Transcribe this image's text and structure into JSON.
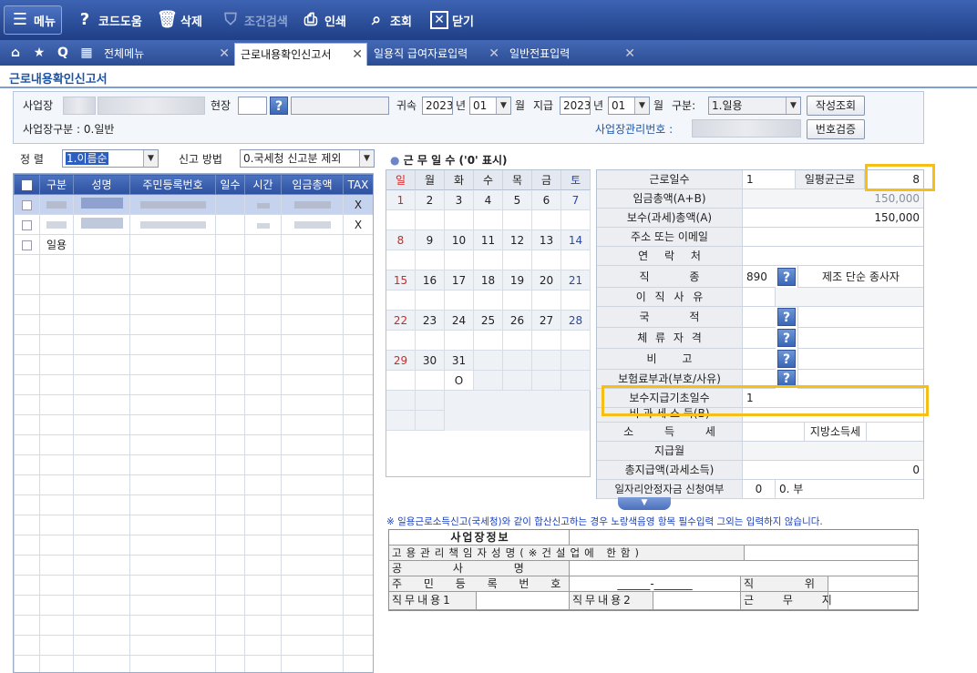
{
  "toolbar": {
    "menu": "메뉴",
    "code_help": "코드도움",
    "delete": "삭제",
    "condition_search": "조건검색",
    "print": "인쇄",
    "view": "조회",
    "close": "닫기"
  },
  "tabs": {
    "all_menu": "전체메뉴",
    "items": [
      "근로내용확인신고서",
      "일용직 급여자료입력",
      "일반전표입력"
    ]
  },
  "page_title": "근로내용확인신고서",
  "search": {
    "workplace_label": "사업장",
    "site_label": "현장",
    "year_label_1": "귀속",
    "year_1": "2023",
    "year_unit_1": "년",
    "month_1": "01",
    "month_unit_1": "월",
    "pay_label": "지급",
    "year_2": "2023",
    "year_unit_2": "년",
    "month_2": "01",
    "month_unit_2": "월",
    "type_label": "구분:",
    "type_value": "1.일용",
    "create_button": "작성조회",
    "workplace_type": "사업장구분 : 0.일반",
    "mgmt_no_label": "사업장관리번호 :",
    "verify_button": "번호검증"
  },
  "sort": {
    "label": "정 렬",
    "value": "1.이름순",
    "method_label": "신고 방법",
    "method_value": "0.국세청 신고분 제외"
  },
  "grid": {
    "headers": [
      "구분",
      "성명",
      "주민등록번호",
      "일수",
      "시간",
      "임금총액",
      "TAX"
    ],
    "rows": [
      {
        "tax": "X"
      },
      {
        "tax": "X"
      },
      {
        "type": "일용"
      }
    ]
  },
  "calendar": {
    "title": "근 무 일 수 ('0' 표시)",
    "weekdays": [
      "일",
      "월",
      "화",
      "수",
      "목",
      "금",
      "토"
    ],
    "weeks": [
      [
        "1",
        "2",
        "3",
        "4",
        "5",
        "6",
        "7"
      ],
      [
        "8",
        "9",
        "10",
        "11",
        "12",
        "13",
        "14"
      ],
      [
        "15",
        "16",
        "17",
        "18",
        "19",
        "20",
        "21"
      ],
      [
        "22",
        "23",
        "24",
        "25",
        "26",
        "27",
        "28"
      ],
      [
        "29",
        "30",
        "31",
        "",
        "",
        "",
        ""
      ]
    ],
    "mark_31": "O"
  },
  "detail": {
    "work_days_label": "근로일수",
    "work_days": "1",
    "daily_avg_label": "일평균근로",
    "daily_avg": "8",
    "wage_total_label": "임금총액(A+B)",
    "wage_total": "150,000",
    "taxable_label": "보수(과세)총액(A)",
    "taxable": "150,000",
    "address_label": "주소 또는 이메일",
    "contact_label": "연 락 처",
    "job_label": "직 종",
    "job_code": "890",
    "job_name": "제조 단순 종사자",
    "resign_label": "이 직 사 유",
    "nation_label": "국 적",
    "stay_label": "체 류 자 격",
    "note_label": "비 고",
    "insurance_label": "보험료부과(부호/사유)",
    "pay_base_days_label": "보수지급기초일수",
    "pay_base_days": "1",
    "nontax_label": "비 과 세 소 득(B)",
    "income_tax_label": "소 득 세",
    "local_tax_label": "지방소득세",
    "pay_month_label": "지급월",
    "total_pay_label": "총지급액(과세소득)",
    "total_pay": "0",
    "job_fund_label": "일자리안정자금 신청여부",
    "job_fund_code": "0",
    "job_fund_value": "0. 부"
  },
  "notice": "※ 일용근로소득신고(국세청)와 같이 합산신고하는 경우 노랑색음영 항목 필수입력 그외는 입력하지 않습니다.",
  "business": {
    "title": "사업장정보",
    "manager_label": "고용관리책임자성명(※건설업에 한함)",
    "company_label": "공 사 명",
    "rrn_label": "주 민 등 록 번 호",
    "rrn_value": "______-_______",
    "position_label": "직 위",
    "duty1_label": "직무내용1",
    "duty2_label": "직무내용2",
    "workplace_label": "근 무 지"
  }
}
